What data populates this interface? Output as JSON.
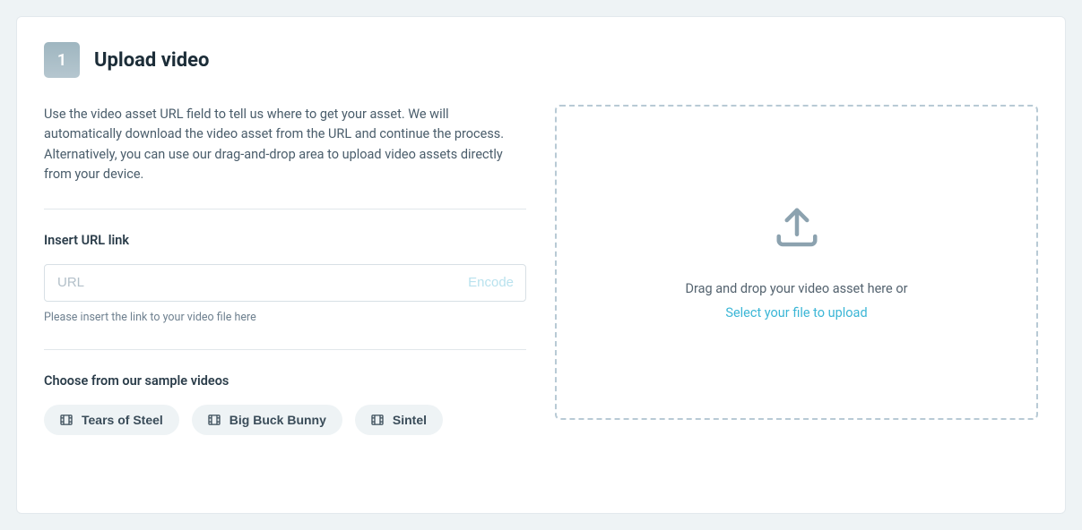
{
  "step": {
    "number": "1",
    "title": "Upload video"
  },
  "description": "Use the video asset URL field to tell us where to get your asset. We will automatically download the video asset from the URL and continue the process. Alternatively, you can use our drag-and-drop area to upload video assets directly from your device.",
  "url_section": {
    "label": "Insert URL link",
    "placeholder": "URL",
    "value": "",
    "action": "Encode",
    "hint": "Please insert the link to your video file here"
  },
  "samples": {
    "label": "Choose from our sample videos",
    "items": [
      {
        "label": "Tears of Steel"
      },
      {
        "label": "Big Buck Bunny"
      },
      {
        "label": "Sintel"
      }
    ]
  },
  "dropzone": {
    "text": "Drag and drop your video asset here or",
    "link": "Select your file to upload"
  }
}
